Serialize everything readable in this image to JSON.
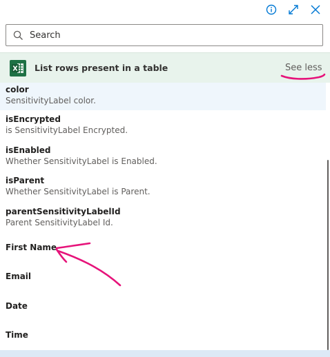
{
  "toolbar": {
    "icons": [
      "info-icon",
      "expand-icon",
      "close-icon"
    ]
  },
  "search": {
    "placeholder": "Search",
    "value": ""
  },
  "action": {
    "title": "List rows present in a table",
    "toggle_label": "See less",
    "icon": "excel-icon",
    "colors": {
      "excel_green": "#1e7145",
      "header_bg": "#e8f3ec",
      "annotation": "#e6137a"
    }
  },
  "items": [
    {
      "title": "color",
      "description": "SensitivityLabel color."
    },
    {
      "title": "isEncrypted",
      "description": "is SensitivityLabel Encrypted."
    },
    {
      "title": "isEnabled",
      "description": "Whether SensitivityLabel is Enabled."
    },
    {
      "title": "isParent",
      "description": "Whether SensitivityLabel is Parent."
    },
    {
      "title": "parentSensitivityLabelId",
      "description": "Parent SensitivityLabel Id."
    },
    {
      "title": "First Name"
    },
    {
      "title": "Email"
    },
    {
      "title": "Date"
    },
    {
      "title": "Time"
    }
  ]
}
